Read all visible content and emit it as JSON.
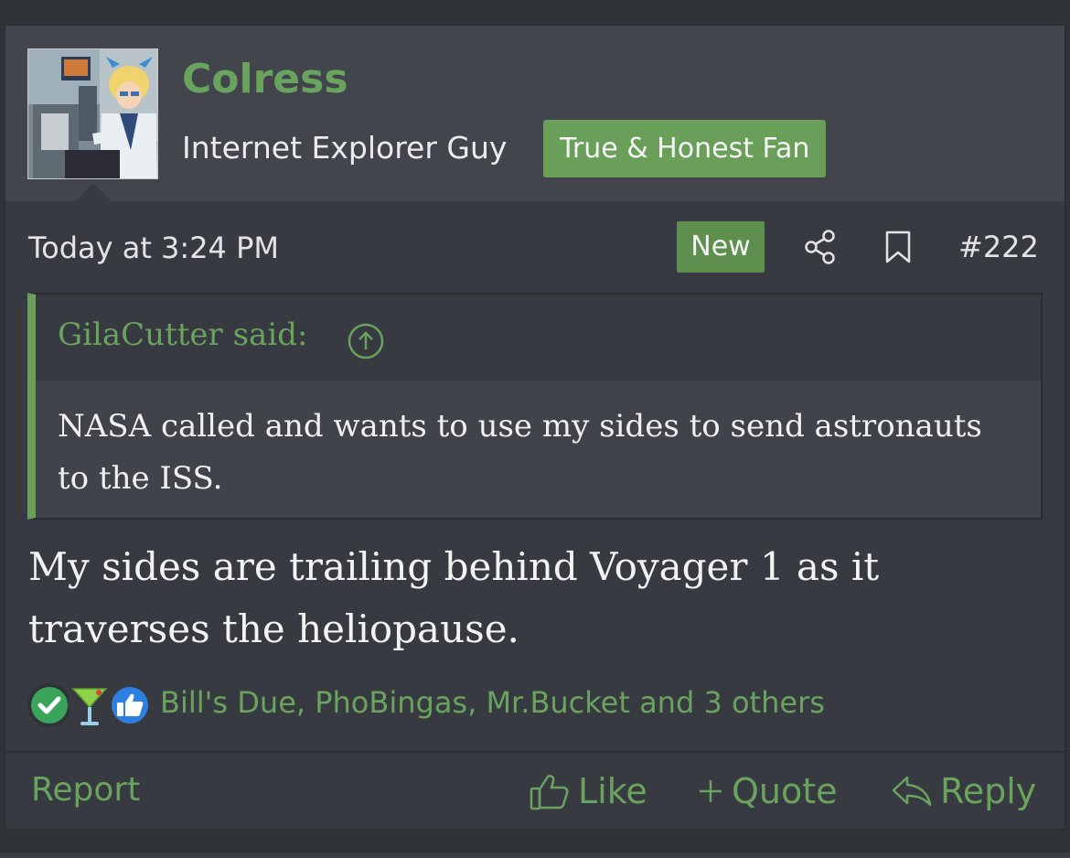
{
  "user": {
    "name": "Colress",
    "title": "Internet Explorer Guy",
    "banner": "True & Honest Fan"
  },
  "meta": {
    "date": "Today at 3:24 PM",
    "new_badge": "New",
    "post_number": "#222",
    "share_icon": "share-icon",
    "bookmark_icon": "bookmark-icon"
  },
  "quote": {
    "author": "GilaCutter said:",
    "text": "NASA called and wants to use my sides to send astronauts to the ISS."
  },
  "body": "My sides are trailing behind Voyager 1 as it traverses the heliopause.",
  "reactions": {
    "icons": [
      "check-reaction-icon",
      "cocktail-reaction-icon",
      "thumbs-up-reaction-icon"
    ],
    "text": "Bill's Due, PhoBingas, Mr.Bucket and 3 others"
  },
  "footer": {
    "report": "Report",
    "like": "Like",
    "quote": "Quote",
    "reply": "Reply"
  },
  "colors": {
    "accent": "#6aa35e",
    "post_bg": "#373a40",
    "header_bg": "#42454c",
    "text": "#f3f3f3"
  }
}
